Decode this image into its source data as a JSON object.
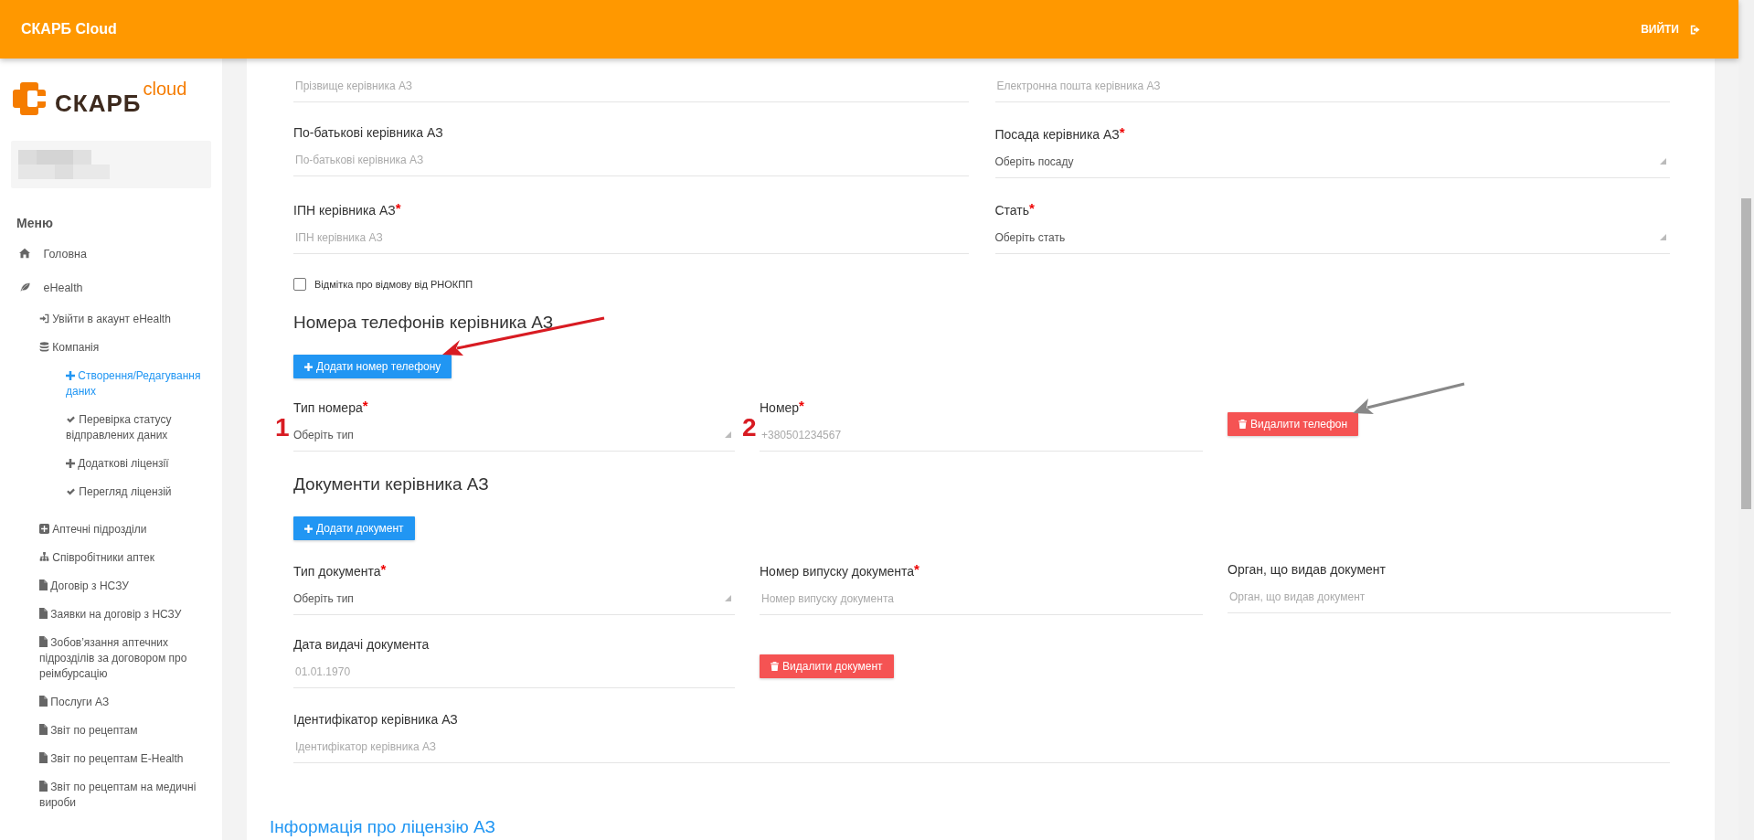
{
  "header": {
    "title": "СКАРБ Cloud",
    "logout": "ВИЙТИ"
  },
  "sidebar": {
    "logo": {
      "brand": "СКАРБ",
      "suffix": "cloud"
    },
    "menu_title": "Меню",
    "items": [
      {
        "label": "Головна",
        "kind": "home",
        "selected": false
      },
      {
        "label": "eHealth",
        "kind": "leaf",
        "selected": false,
        "children": [
          {
            "label": "Увійти в акаунт eHealth",
            "kind": "login",
            "selected": false
          },
          {
            "label": "Компанія",
            "kind": "database",
            "selected": false,
            "children": [
              {
                "label": "Створення/Редагування даних",
                "kind": "plus",
                "selected": true
              },
              {
                "label": "Перевірка статусу відправлених даних",
                "kind": "check",
                "selected": false
              },
              {
                "label": "Додаткові ліцензії",
                "kind": "plus",
                "selected": false
              },
              {
                "label": "Перегляд ліцензій",
                "kind": "check",
                "selected": false
              }
            ]
          },
          {
            "label": "Аптечні підрозділи",
            "kind": "plus-square",
            "selected": false
          },
          {
            "label": "Співробітники аптек",
            "kind": "sitemap",
            "selected": false
          },
          {
            "label": "Договір з НСЗУ",
            "kind": "file",
            "selected": false
          },
          {
            "label": "Заявки на договір з НСЗУ",
            "kind": "file",
            "selected": false
          },
          {
            "label": "Зобов’язання аптечних підрозділів за договором про реімбурсацію",
            "kind": "file",
            "selected": false
          },
          {
            "label": "Послуги АЗ",
            "kind": "file",
            "selected": false
          },
          {
            "label": "Звіт по рецептам",
            "kind": "file",
            "selected": false
          },
          {
            "label": "Звіт по рецептам E-Health",
            "kind": "file",
            "selected": false
          },
          {
            "label": "Звіт по рецептам на медичні вироби",
            "kind": "file",
            "selected": false
          }
        ]
      }
    ]
  },
  "manager_fields": [
    {
      "kind": "input",
      "placeholder": "Прізвище керівника АЗ"
    },
    {
      "kind": "input",
      "placeholder": "Електронна пошта керівника АЗ"
    },
    {
      "label": "По-батькові керівника АЗ",
      "kind": "input",
      "placeholder": "По-батькові керівника АЗ"
    },
    {
      "label": "Посада керівника АЗ",
      "required_mark": "*",
      "kind": "select",
      "placeholder": "Оберіть посаду"
    },
    {
      "label": "ІПН керівника АЗ",
      "required_mark": "*",
      "kind": "input",
      "placeholder": "ІПН керівника АЗ"
    },
    {
      "label": "Стать",
      "required_mark": "*",
      "kind": "select",
      "placeholder": "Оберіть стать"
    }
  ],
  "rnokpp_refusal": {
    "label": "Відмітка про відмову від РНОКПП",
    "checked": false
  },
  "phones": {
    "heading": "Номера телефонів керівника АЗ",
    "add_button": "Додати номер телефону",
    "fields": [
      {
        "label": "Тип номера",
        "required_mark": "*",
        "kind": "select",
        "placeholder": "Оберіть тип"
      },
      {
        "label": "Номер",
        "required_mark": "*",
        "kind": "input",
        "placeholder": "+380501234567"
      }
    ],
    "delete_button": "Видалити телефон"
  },
  "documents": {
    "heading": "Документи керівника АЗ",
    "add_button": "Додати документ",
    "fields": [
      {
        "label": "Тип документа",
        "required_mark": "*",
        "kind": "select",
        "placeholder": "Оберіть тип"
      },
      {
        "label": "Номер випуску документа",
        "required_mark": "*",
        "kind": "input",
        "placeholder": "Номер випуску документа"
      },
      {
        "label": "Орган, що видав документ",
        "kind": "input",
        "placeholder": "Орган, що видав документ"
      },
      {
        "label": "Дата видачі документа",
        "kind": "input",
        "placeholder": "01.01.1970"
      }
    ],
    "delete_button": "Видалити документ"
  },
  "identifier_field": {
    "label": "Ідентифікатор керівника АЗ",
    "kind": "input",
    "placeholder": "Ідентифікатор керівника АЗ"
  },
  "license_heading": "Інформація про ліцензію АЗ",
  "annotations": {
    "markers": [
      "1",
      "2"
    ]
  }
}
